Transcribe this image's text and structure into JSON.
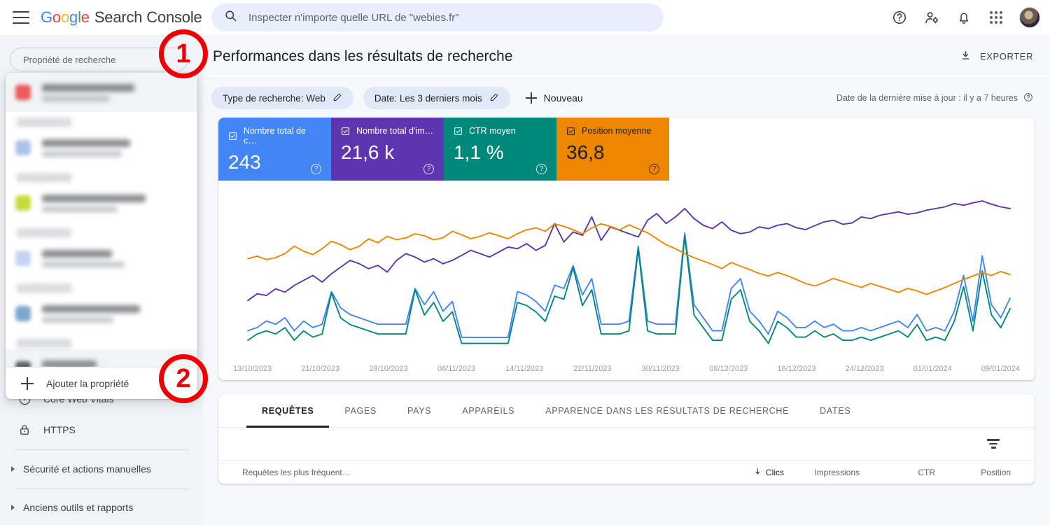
{
  "header": {
    "menu_icon": "hamburger-menu-icon",
    "brand_google": "Google",
    "brand_product": "Search Console",
    "search_placeholder": "Inspecter n'importe quelle URL de \"webies.fr\"",
    "search_value": "",
    "search_icon": "search-icon",
    "help_icon": "help-circle-icon",
    "account_settings_icon": "account-settings-icon",
    "notifications_icon": "bell-icon",
    "apps_icon": "apps-grid-icon",
    "avatar_icon": "user-avatar"
  },
  "sidebar": {
    "property_selector_label": "Propriété de recherche",
    "nav_items": [
      {
        "label": "Core Web Vitals",
        "icon": "speedometer-icon"
      },
      {
        "label": "HTTPS",
        "icon": "lock-icon"
      }
    ],
    "groups": [
      {
        "label": "Sécurité et actions manuelles",
        "icon": "chevron-right-icon"
      },
      {
        "label": "Anciens outils et rapports",
        "icon": "chevron-right-icon"
      }
    ]
  },
  "property_dropdown": {
    "visible": true,
    "add_property_label": "Ajouter la propriété",
    "add_property_icon": "plus-icon",
    "rows": [
      {
        "favicon_color": "#EA5B5B",
        "title_width": 132,
        "sub_width": 96,
        "selected": true,
        "section": null
      },
      {
        "favicon_color": "#AEC3EC",
        "title_width": 126,
        "sub_width": 114,
        "selected": false,
        "section": "blurred"
      },
      {
        "favicon_color": "#C6DB38",
        "title_width": 148,
        "sub_width": 108,
        "selected": false,
        "section": "blurred"
      },
      {
        "favicon_color": "#C3D4F0",
        "title_width": 100,
        "sub_width": 118,
        "selected": false,
        "section": "blurred"
      },
      {
        "favicon_color": "#7BA7CC",
        "title_width": 140,
        "sub_width": 102,
        "selected": false,
        "section": "blurred"
      },
      {
        "favicon_color": "#5F6368",
        "title_width": 78,
        "sub_width": 110,
        "selected": true,
        "section": "blurred"
      }
    ]
  },
  "page": {
    "title": "Performances dans les résultats de recherche",
    "export_label": "EXPORTER",
    "export_icon": "download-icon"
  },
  "filters": {
    "chips": [
      {
        "label": "Type de recherche: Web",
        "edit_icon": "pencil-icon"
      },
      {
        "label": "Date: Les 3 derniers mois",
        "edit_icon": "pencil-icon"
      }
    ],
    "new_label": "Nouveau",
    "new_icon": "plus-icon",
    "last_update": "Date de la dernière mise à jour : il y a 7 heures",
    "last_update_icon": "help-circle-icon"
  },
  "metrics": [
    {
      "label": "Nombre total de c…",
      "value": "243",
      "color": "#4285F4",
      "checked": true,
      "help_icon": "help-circle-icon"
    },
    {
      "label": "Nombre total d'im…",
      "value": "21,6 k",
      "color": "#5E35B1",
      "checked": true,
      "help_icon": "help-circle-icon"
    },
    {
      "label": "CTR moyen",
      "value": "1,1 %",
      "color": "#00897B",
      "checked": true,
      "help_icon": "help-circle-icon"
    },
    {
      "label": "Position moyenne",
      "value": "36,8",
      "color": "#EF8600",
      "checked": true,
      "help_icon": "help-circle-icon"
    }
  ],
  "chart_data": {
    "type": "line",
    "title": "Performances dans les résultats de recherche",
    "xlabel": "",
    "ylabel": "",
    "grid": false,
    "legend_position": "top-cards",
    "tick_labels": [
      "13/10/2023",
      "21/10/2023",
      "29/10/2023",
      "06/11/2023",
      "14/11/2023",
      "22/11/2023",
      "30/11/2023",
      "08/12/2023",
      "16/12/2023",
      "24/12/2023",
      "01/01/2024",
      "09/01/2024"
    ],
    "tick_interval_days": 8,
    "x_range": [
      "13/10/2023",
      "12/01/2024"
    ],
    "series": [
      {
        "name": "Nombre total de clics",
        "color": "#4285F4",
        "total": "243",
        "values": [
          2,
          3,
          5,
          4,
          6,
          2,
          5,
          3,
          4,
          14,
          9,
          7,
          6,
          5,
          4,
          4,
          4,
          4,
          15,
          10,
          14,
          8,
          11,
          0,
          0,
          0,
          0,
          0,
          0,
          14,
          13,
          11,
          8,
          16,
          15,
          22,
          13,
          18,
          4,
          4,
          4,
          5,
          28,
          5,
          4,
          4,
          4,
          32,
          10,
          6,
          2,
          2,
          15,
          18,
          8,
          5,
          1,
          8,
          6,
          3,
          3,
          5,
          3,
          4,
          2,
          2,
          3,
          2,
          3,
          4,
          5,
          3,
          7,
          2,
          3,
          2,
          8,
          19,
          5,
          25,
          10,
          6,
          12
        ]
      },
      {
        "name": "Nombre total d'impressions",
        "color": "#5E35B1",
        "total": "21,6 k",
        "values": [
          180,
          200,
          195,
          215,
          205,
          225,
          240,
          255,
          235,
          260,
          280,
          300,
          290,
          275,
          285,
          265,
          300,
          320,
          310,
          295,
          305,
          290,
          300,
          315,
          330,
          320,
          310,
          325,
          340,
          335,
          350,
          330,
          345,
          410,
          355,
          385,
          375,
          430,
          360,
          400,
          390,
          380,
          370,
          420,
          440,
          410,
          430,
          455,
          425,
          405,
          395,
          415,
          390,
          380,
          385,
          400,
          395,
          405,
          410,
          398,
          392,
          404,
          415,
          420,
          408,
          412,
          430,
          425,
          435,
          440,
          445,
          438,
          442,
          450,
          455,
          460,
          470,
          465,
          472,
          478,
          468,
          460,
          455
        ]
      },
      {
        "name": "CTR moyen",
        "color": "#00897B",
        "total": "1,1 %",
        "values": [
          1,
          3,
          4,
          3,
          5,
          1,
          4,
          2,
          3,
          16,
          8,
          6,
          5,
          4,
          3,
          3,
          3,
          3,
          17,
          9,
          13,
          7,
          10,
          0,
          0,
          0,
          0,
          0,
          0,
          13,
          12,
          10,
          7,
          15,
          14,
          24,
          12,
          17,
          3,
          3,
          3,
          4,
          30,
          4,
          3,
          3,
          3,
          34,
          9,
          5,
          1,
          1,
          14,
          17,
          7,
          4,
          0,
          7,
          5,
          2,
          2,
          4,
          2,
          3,
          1,
          1,
          2,
          1,
          2,
          3,
          4,
          2,
          6,
          1,
          2,
          1,
          7,
          18,
          4,
          23,
          9,
          5,
          11
        ]
      },
      {
        "name": "Position moyenne",
        "color": "#EF8600",
        "total": "36,8",
        "values": [
          520,
          525,
          518,
          522,
          530,
          545,
          535,
          528,
          540,
          555,
          548,
          538,
          545,
          560,
          552,
          565,
          558,
          562,
          570,
          566,
          558,
          562,
          575,
          568,
          560,
          565,
          572,
          566,
          560,
          570,
          578,
          582,
          575,
          590,
          585,
          578,
          570,
          582,
          590,
          585,
          578,
          588,
          580,
          572,
          560,
          548,
          540,
          530,
          522,
          515,
          508,
          500,
          512,
          505,
          498,
          490,
          485,
          492,
          486,
          478,
          470,
          465,
          472,
          480,
          474,
          468,
          462,
          470,
          464,
          458,
          452,
          460,
          455,
          448,
          455,
          462,
          470,
          478,
          485,
          492,
          486,
          494,
          488
        ]
      }
    ]
  },
  "result_tabs": [
    {
      "label": "REQUÊTES",
      "active": true
    },
    {
      "label": "PAGES",
      "active": false
    },
    {
      "label": "PAYS",
      "active": false
    },
    {
      "label": "APPAREILS",
      "active": false
    },
    {
      "label": "APPARENCE DANS LES RÉSULTATS DE RECHERCHE",
      "active": false
    },
    {
      "label": "DATES",
      "active": false
    }
  ],
  "table": {
    "filter_icon": "filter-funnel-icon",
    "sort_icon": "arrow-down-icon",
    "columns": {
      "query": "Requêtes les plus fréquent…",
      "clicks": "Clics",
      "impressions": "Impressions",
      "ctr": "CTR",
      "position": "Position"
    },
    "sorted_by": "Clics",
    "rows": []
  },
  "annotations": [
    {
      "number": "1",
      "color": "#EF0000"
    },
    {
      "number": "2",
      "color": "#EF0000"
    }
  ]
}
